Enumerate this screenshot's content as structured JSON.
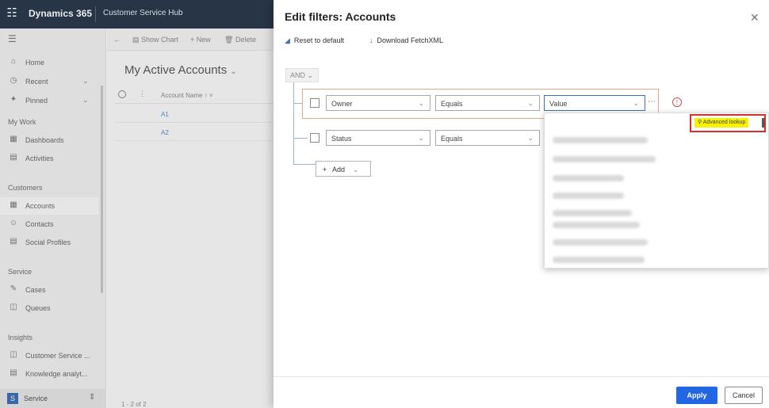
{
  "topbar": {
    "app_name": "Dynamics 365",
    "hub_name": "Customer Service Hub",
    "waffle_icon": "waffle-icon"
  },
  "sidebar": {
    "items_top": [
      {
        "label": "Home",
        "icon": "home-icon"
      },
      {
        "label": "Recent",
        "icon": "clock-icon"
      },
      {
        "label": "Pinned",
        "icon": "pin-icon"
      }
    ],
    "sections": [
      {
        "header": "My Work",
        "items": [
          {
            "label": "Dashboards"
          },
          {
            "label": "Activities"
          }
        ]
      },
      {
        "header": "Customers",
        "items": [
          {
            "label": "Accounts"
          },
          {
            "label": "Contacts"
          },
          {
            "label": "Social Profiles"
          }
        ]
      },
      {
        "header": "Service",
        "items": [
          {
            "label": "Cases"
          },
          {
            "label": "Queues"
          }
        ]
      },
      {
        "header": "Insights",
        "items": [
          {
            "label": "Customer Service ..."
          },
          {
            "label": "Knowledge analyt..."
          }
        ]
      }
    ],
    "area": {
      "badge": "S",
      "label": "Service"
    }
  },
  "main": {
    "commands": {
      "show_chart": "Show Chart",
      "new": "New",
      "delete": "Delete"
    },
    "view_title": "My Active Accounts",
    "column_header": "Account Name ↑ ˅",
    "rows": [
      "A1",
      "A2"
    ],
    "pager": "1 - 2 of 2"
  },
  "panel": {
    "title": "Edit filters: Accounts",
    "reset_label": "Reset to default",
    "download_label": "Download FetchXML",
    "and_label": "AND",
    "row1": {
      "field": "Owner",
      "operator": "Equals",
      "value_placeholder": "Value"
    },
    "row2": {
      "field": "Status",
      "operator": "Equals"
    },
    "add_label": "Add",
    "dropdown": {
      "advanced_lookup": "Advanced lookup"
    },
    "apply_label": "Apply",
    "cancel_label": "Cancel"
  },
  "colors": {
    "topbar": "#2b3a4e",
    "accent": "#2266e3",
    "highlight_border": "#d62f2f",
    "row_border": "#e0a78f"
  }
}
